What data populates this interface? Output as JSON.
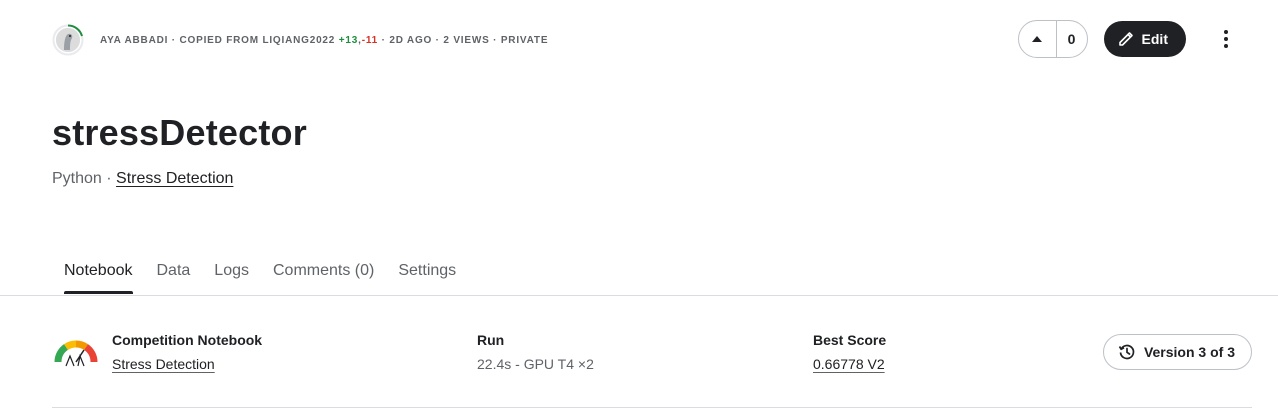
{
  "header": {
    "author": "AYA ABBADI",
    "copied_prefix": "· COPIED FROM LIQIANG2022",
    "diff_plus": "+13",
    "diff_sep": ",",
    "diff_minus": "-11",
    "meta_suffix": "· 2D AGO · 2 VIEWS · PRIVATE",
    "vote_count": "0",
    "edit_label": "Edit"
  },
  "notebook": {
    "title": "stressDetector",
    "language": "Python",
    "separator": "·",
    "competition_link": "Stress Detection"
  },
  "tabs": [
    {
      "label": "Notebook",
      "active": true
    },
    {
      "label": "Data",
      "active": false
    },
    {
      "label": "Logs",
      "active": false
    },
    {
      "label": "Comments (0)",
      "active": false
    },
    {
      "label": "Settings",
      "active": false
    }
  ],
  "info": {
    "competition_label": "Competition Notebook",
    "competition_value": "Stress Detection",
    "run_label": "Run",
    "run_value": "22.4s - GPU T4 ×2",
    "score_label": "Best Score",
    "score_value": "0.66778 V2",
    "version_label": "Version 3 of 3"
  },
  "icons": {
    "avatar": "user-avatar-icon",
    "upvote": "triangle-up-icon",
    "edit": "pencil-icon",
    "more": "vertical-dots-icon",
    "version": "history-icon",
    "competition": "stress-gauge-icon"
  },
  "colors": {
    "primary_dark": "#202124",
    "muted_text": "#5f6368",
    "diff_plus": "#1e8e3e",
    "diff_minus": "#d93025",
    "avatar_ring": "#1e8e3e"
  }
}
